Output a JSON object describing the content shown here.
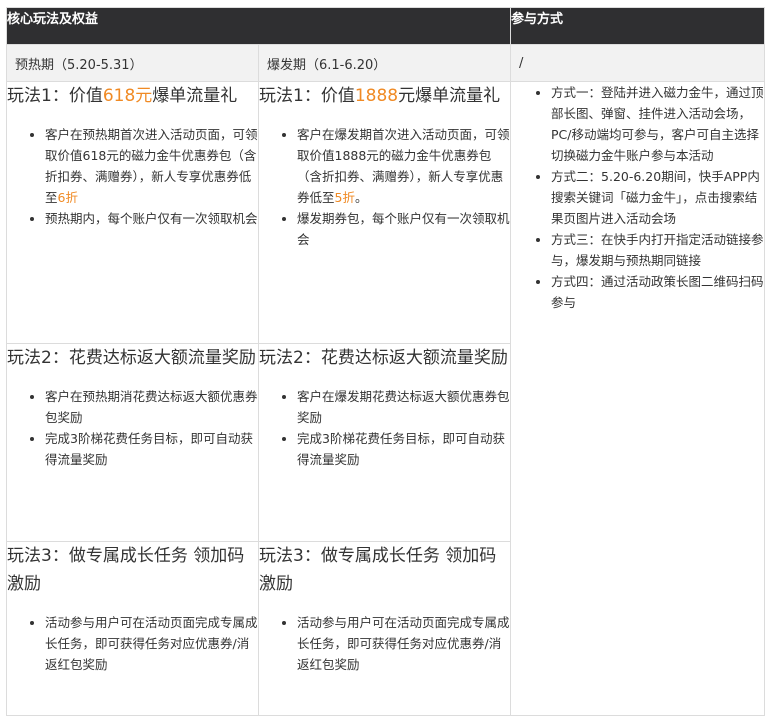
{
  "header": {
    "col1_title": "核心玩法及权益",
    "col2_title": "参与方式"
  },
  "periods": {
    "preheat": "预热期（5.20-5.31）",
    "burst": "爆发期（6.1-6.20）",
    "join_placeholder": "/"
  },
  "preheat": {
    "play1": {
      "title_pre": "玩法1：价值",
      "title_hl": "618元",
      "title_post": "爆单流量礼",
      "b1_pre": "客户在预热期首次进入活动页面，可领取价值618元的磁力金牛优惠券包（含折扣券、满赠券），新人专享优惠券低至",
      "b1_hl": "6折",
      "b2": "预热期内，每个账户仅有一次领取机会"
    },
    "play2": {
      "title": "玩法2：花费达标返大额流量奖励",
      "b1": "客户在预热期消花费达标返大额优惠券包奖励",
      "b2": "完成3阶梯花费任务目标，即可自动获得流量奖励"
    },
    "play3": {
      "title": "玩法3：做专属成长任务 领加码激励",
      "b1": "活动参与用户可在活动页面完成专属成长任务，即可获得任务对应优惠券/消返红包奖励"
    }
  },
  "burst": {
    "play1": {
      "title_pre": "玩法1：价值",
      "title_hl": "1888",
      "title_post": "元爆单流量礼",
      "b1_pre": "客户在爆发期首次进入活动页面，可领取价值1888元的磁力金牛优惠券包（含折扣券、满赠券），新人专享优惠券低至",
      "b1_hl": "5折",
      "b1_post": "。",
      "b2": "爆发期券包，每个账户仅有一次领取机会"
    },
    "play2": {
      "title": "玩法2：花费达标返大额流量奖励",
      "b1": "客户在爆发期花费达标返大额优惠券包奖励",
      "b2": "完成3阶梯花费任务目标，即可自动获得流量奖励"
    },
    "play3": {
      "title": "玩法3：做专属成长任务 领加码激励",
      "b1": "活动参与用户可在活动页面完成专属成长任务，即可获得任务对应优惠券/消返红包奖励"
    }
  },
  "join_methods": [
    "方式一：登陆并进入磁力金牛，通过顶部长图、弹窗、挂件进入活动会场，PC/移动端均可参与，客户可自主选择切换磁力金牛账户参与本活动",
    "方式二：5.20-6.20期间，快手APP内搜索关键词「磁力金牛」，点击搜索结果页图片进入活动会场",
    "方式三：在快手内打开指定活动链接参与，爆发期与预热期同链接",
    "方式四：通过活动政策长图二维码扫码参与"
  ],
  "colors": {
    "header_bg": "#2f2f31",
    "subheader_bg": "#f2f2f2",
    "highlight": "#f08a24"
  }
}
